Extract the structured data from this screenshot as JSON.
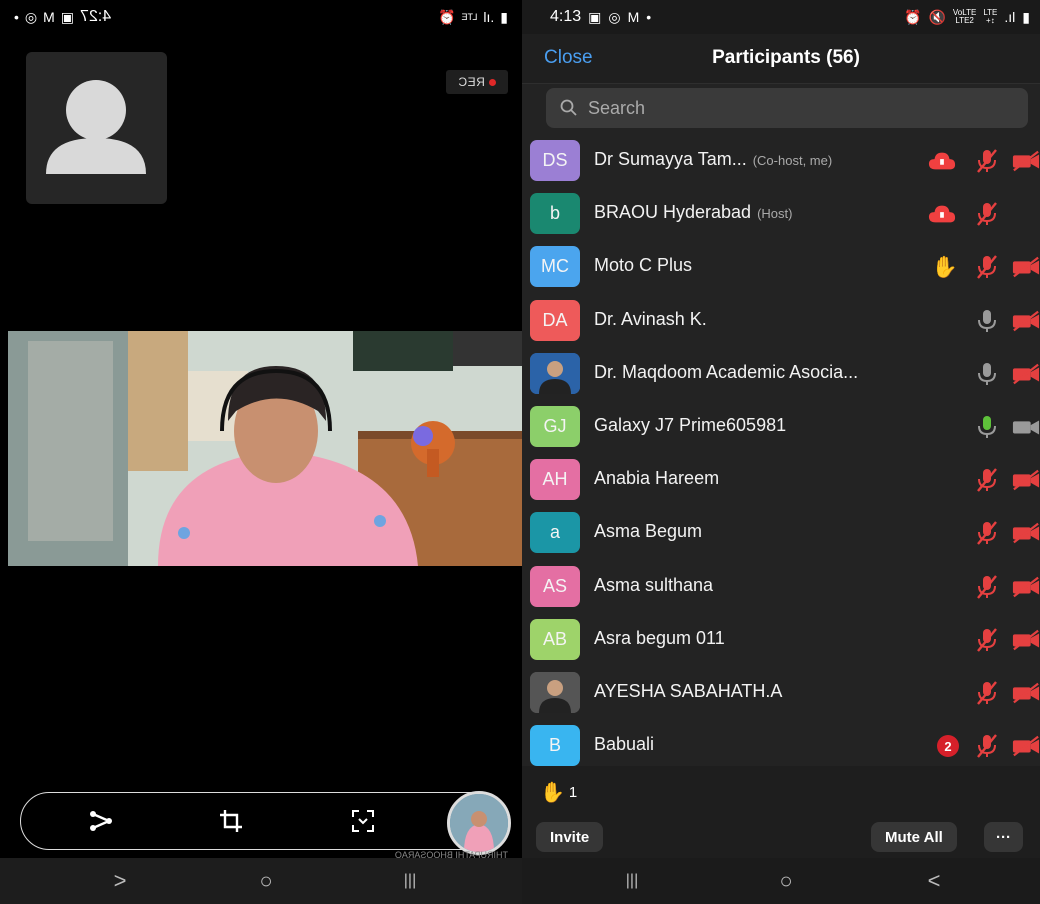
{
  "left_panel": {
    "status_time": "4:27",
    "rec_label": "REC",
    "video_caption": "THIRUPATHI BHOOSARAO"
  },
  "status_bar": {
    "time": "4:13",
    "net_top": "VoLTE",
    "net_bottom": "LTE2",
    "lte_top": "LTE",
    "lte_bottom": "+↕"
  },
  "header": {
    "close_label": "Close",
    "title": "Participants (56)"
  },
  "search": {
    "placeholder": "Search"
  },
  "participants": [
    {
      "initials": "DS",
      "name": "Dr Sumayya Tam...",
      "role": "(Co-host, me)",
      "color": "#9b7fd4",
      "cloud": true,
      "hand": false,
      "mic": "muted",
      "video": "off",
      "badge": ""
    },
    {
      "initials": "b",
      "name": "BRAOU Hyderabad",
      "role": "(Host)",
      "color": "#1a8870",
      "cloud": true,
      "hand": false,
      "mic": "muted",
      "video": "none",
      "badge": ""
    },
    {
      "initials": "MC",
      "name": "Moto C Plus",
      "role": "",
      "color": "#4ba5ee",
      "cloud": false,
      "hand": true,
      "mic": "muted",
      "video": "off",
      "badge": ""
    },
    {
      "initials": "DA",
      "name": "Dr. Avinash K.",
      "role": "",
      "color": "#ee5a5a",
      "cloud": false,
      "hand": false,
      "mic": "on",
      "video": "off",
      "badge": ""
    },
    {
      "initials": "",
      "name": "Dr. Maqdoom Academic Asocia...",
      "role": "",
      "color": "#2b63a8",
      "photo": true,
      "cloud": false,
      "hand": false,
      "mic": "on",
      "video": "off",
      "badge": ""
    },
    {
      "initials": "GJ",
      "name": "Galaxy J7 Prime605981",
      "role": "",
      "color": "#8ccf6a",
      "cloud": false,
      "hand": false,
      "mic": "speaking",
      "video": "on",
      "badge": ""
    },
    {
      "initials": "AH",
      "name": "Anabia Hareem",
      "role": "",
      "color": "#e46fa3",
      "cloud": false,
      "hand": false,
      "mic": "muted",
      "video": "off",
      "badge": ""
    },
    {
      "initials": "a",
      "name": "Asma Begum",
      "role": "",
      "color": "#1b96a6",
      "cloud": false,
      "hand": false,
      "mic": "muted",
      "video": "off",
      "badge": ""
    },
    {
      "initials": "AS",
      "name": "Asma sulthana",
      "role": "",
      "color": "#e46fa3",
      "cloud": false,
      "hand": false,
      "mic": "muted",
      "video": "off",
      "badge": ""
    },
    {
      "initials": "AB",
      "name": "Asra begum 011",
      "role": "",
      "color": "#9ed36a",
      "cloud": false,
      "hand": false,
      "mic": "muted",
      "video": "off",
      "badge": ""
    },
    {
      "initials": "",
      "name": "AYESHA SABAHATH.A",
      "role": "",
      "color": "#555555",
      "photo": true,
      "cloud": false,
      "hand": false,
      "mic": "muted",
      "video": "off",
      "badge": ""
    },
    {
      "initials": "B",
      "name": "Babuali",
      "role": "",
      "color": "#39b5f0",
      "cloud": false,
      "hand": false,
      "mic": "muted",
      "video": "off",
      "badge": "2"
    }
  ],
  "footer": {
    "raised_count": "1",
    "invite_label": "Invite",
    "mute_all_label": "Mute All",
    "more_label": "···"
  },
  "nav": {
    "back": "<",
    "home": "○",
    "recents": "|||"
  }
}
